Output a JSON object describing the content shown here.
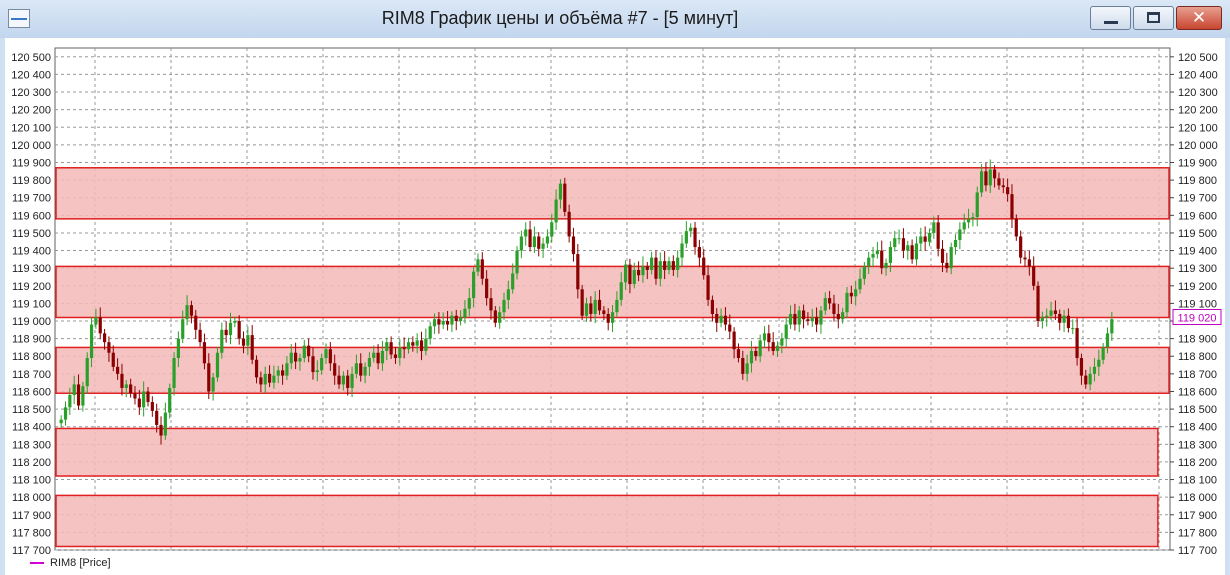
{
  "window": {
    "title": "RIM8 График цены и объёма #7 - [5 минут]",
    "minimize_icon": "minimize-icon",
    "maximize_icon": "maximize-icon",
    "close_icon": "close-icon",
    "close_glyph": "✕"
  },
  "legend": {
    "label": "RIM8 [Price]",
    "color": "#d000d0"
  },
  "chart_data": {
    "type": "candlestick",
    "title": "",
    "ylim": [
      117700,
      120550
    ],
    "y_ticks": [
      "120 500",
      "120 400",
      "120 300",
      "120 200",
      "120 100",
      "120 000",
      "119 900",
      "119 800",
      "119 700",
      "119 600",
      "119 500",
      "119 400",
      "119 300",
      "119 200",
      "119 100",
      "119 000",
      "118 900",
      "118 800",
      "118 700",
      "118 600",
      "118 500",
      "118 400",
      "118 300",
      "118 200",
      "118 100",
      "118 000",
      "117 900",
      "117 800",
      "117 700"
    ],
    "y_tick_values": [
      120500,
      120400,
      120300,
      120200,
      120100,
      120000,
      119900,
      119800,
      119700,
      119600,
      119500,
      119400,
      119300,
      119200,
      119100,
      119000,
      118900,
      118800,
      118700,
      118600,
      118500,
      118400,
      118300,
      118200,
      118100,
      118000,
      117900,
      117800,
      117700
    ],
    "last_price": {
      "label": "119 020",
      "value": 119020,
      "color": "#c000c0"
    },
    "up_color": "#2aa02a",
    "down_color": "#8b0000",
    "zone_color": "#f4b8b8",
    "zone_border": "#e02020",
    "zones": [
      {
        "from": 119580,
        "to": 119870,
        "end": 1
      },
      {
        "from": 119020,
        "to": 119310,
        "end": 1
      },
      {
        "from": 118590,
        "to": 118850,
        "end": 1
      },
      {
        "from": 118120,
        "to": 118390,
        "end": 0.99
      },
      {
        "from": 117720,
        "to": 118010,
        "end": 0.99
      }
    ],
    "series_close": [
      118440,
      118510,
      118580,
      118640,
      118520,
      118630,
      118790,
      118980,
      119020,
      118930,
      118880,
      118820,
      118740,
      118700,
      118620,
      118640,
      118590,
      118560,
      118510,
      118600,
      118540,
      118490,
      118410,
      118350,
      118480,
      118620,
      118790,
      118900,
      119010,
      119090,
      119030,
      118950,
      118880,
      118760,
      118600,
      118680,
      118820,
      118950,
      118920,
      118990,
      119000,
      118900,
      118860,
      118920,
      118780,
      118680,
      118640,
      118700,
      118650,
      118690,
      118720,
      118690,
      118760,
      118820,
      118770,
      118790,
      118860,
      118800,
      118710,
      118720,
      118790,
      118840,
      118760,
      118690,
      118640,
      118690,
      118620,
      118700,
      118760,
      118690,
      118740,
      118790,
      118820,
      118760,
      118830,
      118880,
      118810,
      118790,
      118850,
      118840,
      118880,
      118860,
      118890,
      118830,
      118900,
      118970,
      119010,
      118980,
      119000,
      118980,
      119030,
      119000,
      119020,
      119070,
      119130,
      119280,
      119350,
      119240,
      119130,
      119060,
      118990,
      119050,
      119120,
      119180,
      119270,
      119400,
      119480,
      119520,
      119420,
      119480,
      119410,
      119440,
      119480,
      119560,
      119690,
      119780,
      119620,
      119480,
      119380,
      119180,
      119030,
      119100,
      119040,
      119120,
      119060,
      119040,
      118990,
      119050,
      119120,
      119220,
      119320,
      119210,
      119290,
      119260,
      119310,
      119290,
      119360,
      119240,
      119340,
      119290,
      119340,
      119290,
      119360,
      119440,
      119510,
      119530,
      119420,
      119360,
      119260,
      119120,
      119040,
      118990,
      119030,
      118980,
      118940,
      118840,
      118790,
      118700,
      118760,
      118830,
      118800,
      118890,
      118930,
      118880,
      118830,
      118860,
      118900,
      118980,
      119040,
      118980,
      119060,
      119010,
      119000,
      119020,
      118980,
      119060,
      119130,
      119100,
      119040,
      119010,
      119050,
      119160,
      119140,
      119180,
      119240,
      119310,
      119360,
      119380,
      119400,
      119300,
      119330,
      119420,
      119470,
      119470,
      119400,
      119430,
      119350,
      119440,
      119480,
      119450,
      119500,
      119560,
      119410,
      119330,
      119300,
      119420,
      119460,
      119520,
      119560,
      119580,
      119590,
      119730,
      119850,
      119770,
      119860,
      119810,
      119770,
      119760,
      119720,
      119580,
      119480,
      119360,
      119350,
      119310,
      119200,
      119000,
      119020,
      119030,
      119060,
      119040,
      118990,
      119030,
      118960,
      118960,
      118790,
      118690,
      118640,
      118700,
      118740,
      118780,
      118850,
      118930,
      119010
    ]
  }
}
